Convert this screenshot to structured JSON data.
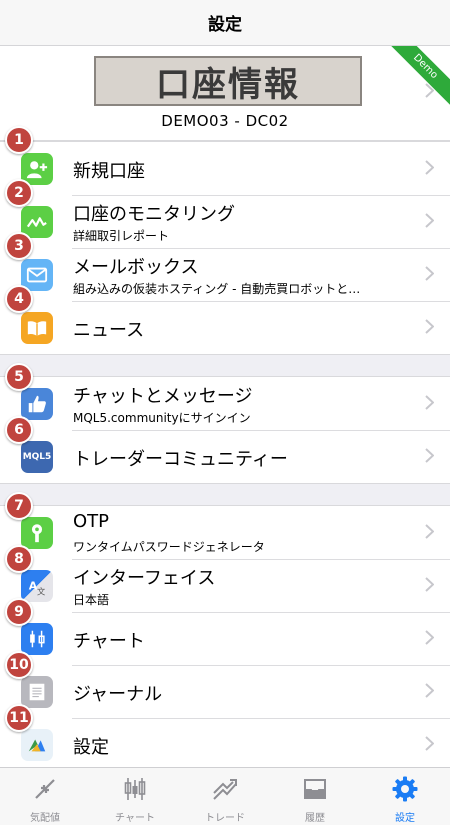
{
  "navbar": {
    "title": "設定"
  },
  "account": {
    "banner": "口座情報",
    "name": "DEMO03 - DC02",
    "ribbon": "Demo"
  },
  "section1": [
    {
      "badge": "1",
      "label": "新規口座",
      "sub": "",
      "icon": "new-account-icon",
      "color": "#5ccf45"
    },
    {
      "badge": "2",
      "label": "口座のモニタリング",
      "sub": "詳細取引レポート",
      "icon": "monitoring-icon",
      "color": "#5ccf45"
    },
    {
      "badge": "3",
      "label": "メールボックス",
      "sub": "組み込みの仮装ホスティング - 自動売買ロボットと…",
      "icon": "mail-icon",
      "color": "#64b5f6"
    },
    {
      "badge": "4",
      "label": "ニュース",
      "sub": "",
      "icon": "news-icon",
      "color": "#f5a623"
    }
  ],
  "section2": [
    {
      "badge": "5",
      "label": "チャットとメッセージ",
      "sub": "MQL5.communityにサインイン",
      "icon": "chat-icon",
      "color": "#4a86d9"
    },
    {
      "badge": "6",
      "label": "トレーダーコミュニティー",
      "sub": "",
      "icon": "mql5-icon",
      "color": "#3d68b0",
      "icon_text": "MQL5"
    }
  ],
  "section3": [
    {
      "badge": "7",
      "label": "OTP",
      "sub": "ワンタイムパスワードジェネレータ",
      "icon": "otp-key-icon",
      "color": "#5ccf45"
    },
    {
      "badge": "8",
      "label": "インターフェイス",
      "sub": "日本語",
      "icon": "language-icon",
      "color": "#2d7ff0"
    },
    {
      "badge": "9",
      "label": "チャート",
      "sub": "",
      "icon": "candlestick-icon",
      "color": "#2d7ff0"
    },
    {
      "badge": "10",
      "label": "ジャーナル",
      "sub": "",
      "icon": "journal-icon",
      "color": "#b8b8be"
    },
    {
      "badge": "11",
      "label": "設定",
      "sub": "",
      "icon": "metatrader-icon",
      "color": "#e8f1f8"
    }
  ],
  "tabs": [
    {
      "label": "気配値",
      "icon": "quotes-icon",
      "active": false
    },
    {
      "label": "チャート",
      "icon": "chart-icon",
      "active": false
    },
    {
      "label": "トレード",
      "icon": "trade-icon",
      "active": false
    },
    {
      "label": "履歴",
      "icon": "history-icon",
      "active": false
    },
    {
      "label": "設定",
      "icon": "settings-icon",
      "active": true
    }
  ],
  "colors": {
    "accent": "#1a7cf4",
    "badge": "#c0443e",
    "ribbon": "#2eaa3a"
  }
}
